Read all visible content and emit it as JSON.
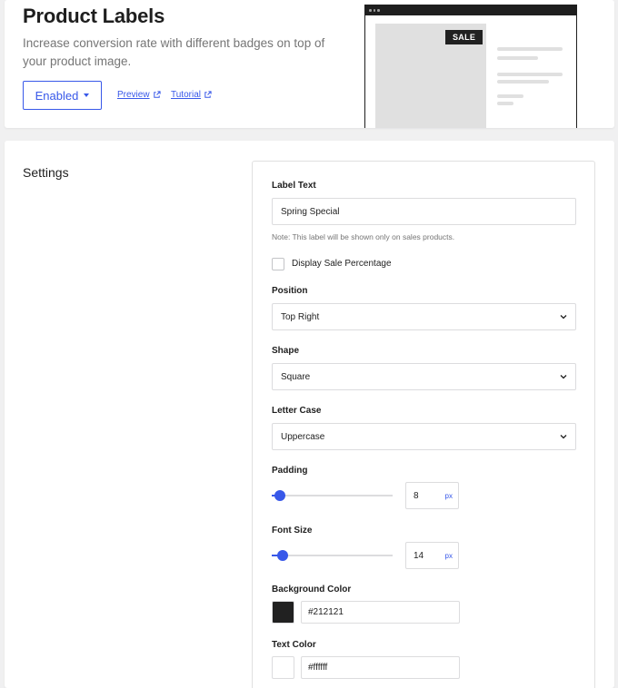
{
  "header": {
    "title": "Product Labels",
    "description": "Increase conversion rate with different badges on top of your product image.",
    "status_button": "Enabled",
    "preview_link": "Preview",
    "tutorial_link": "Tutorial",
    "preview_badge": "SALE"
  },
  "settings": {
    "title": "Settings",
    "label_text": {
      "label": "Label Text",
      "value": "Spring Special",
      "note": "Note: This label will be shown only on sales products."
    },
    "display_sale_percentage": {
      "label": "Display Sale Percentage",
      "checked": false
    },
    "position": {
      "label": "Position",
      "value": "Top Right"
    },
    "shape": {
      "label": "Shape",
      "value": "Square"
    },
    "letter_case": {
      "label": "Letter Case",
      "value": "Uppercase"
    },
    "padding": {
      "label": "Padding",
      "value": "8",
      "unit": "px",
      "slider_fraction": 0.07
    },
    "font_size": {
      "label": "Font Size",
      "value": "14",
      "unit": "px",
      "slider_fraction": 0.09
    },
    "background_color": {
      "label": "Background Color",
      "value": "#212121"
    },
    "text_color": {
      "label": "Text Color",
      "value": "#ffffff"
    }
  },
  "colors": {
    "accent": "#3858e9",
    "badge_bg": "#212121"
  },
  "icons": {
    "external": "external-link-icon",
    "caret": "caret-down-icon",
    "chevron": "chevron-down-icon"
  }
}
